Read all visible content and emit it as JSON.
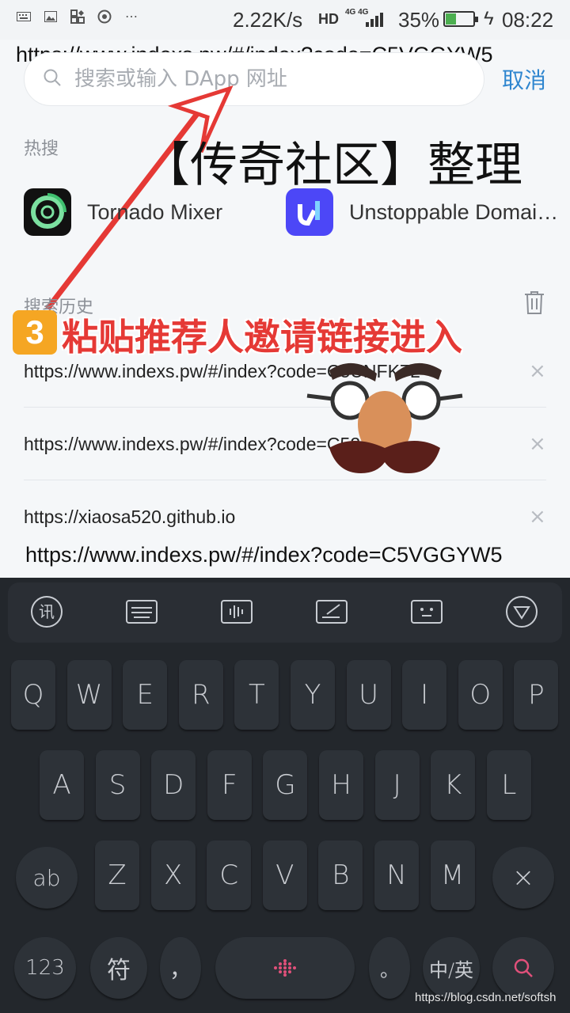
{
  "status": {
    "speed": "2.22K/s",
    "hd": "HD",
    "net_top": "4G 4G",
    "battery_pct": "35%",
    "battery_level": 0.35,
    "time": "08:22"
  },
  "overlay": {
    "url_top": "https://www.indexs.pw/#/index?code=C5VGGYW5",
    "url_bottom": "https://www.indexs.pw/#/index?code=C5VGGYW5",
    "headline": "【传奇社区】整理",
    "step_num": "3",
    "step_text": "粘贴推荐人邀请链接进入"
  },
  "search": {
    "placeholder": "搜索或输入 DApp 网址",
    "cancel": "取消"
  },
  "hot": {
    "title": "热搜",
    "apps": [
      {
        "name": "Tornado Mixer"
      },
      {
        "name": "Unstoppable Domai…"
      }
    ]
  },
  "history": {
    "title": "搜索历史",
    "items": [
      "https://www.indexs.pw/#/index?code=C5UNFK7L",
      "https://www.indexs.pw/#/index?code=C528PD",
      "https://xiaosa520.github.io"
    ]
  },
  "keyboard": {
    "toolbar": [
      "logo-icon",
      "keyboard-icon",
      "voice-icon",
      "handwrite-icon",
      "emoji-icon",
      "collapse-icon"
    ],
    "row1": [
      "Q",
      "W",
      "E",
      "R",
      "T",
      "Y",
      "U",
      "I",
      "O",
      "P"
    ],
    "row2": [
      "A",
      "S",
      "D",
      "F",
      "G",
      "H",
      "J",
      "K",
      "L"
    ],
    "row3": [
      "Z",
      "X",
      "C",
      "V",
      "B",
      "N",
      "M"
    ],
    "shift": "ab",
    "delete": "×",
    "num": "123",
    "sym": "符",
    "comma": "，",
    "period": "。",
    "lang": "中/英",
    "logo_char": "讯"
  },
  "watermark": "https://blog.csdn.net/softsh"
}
